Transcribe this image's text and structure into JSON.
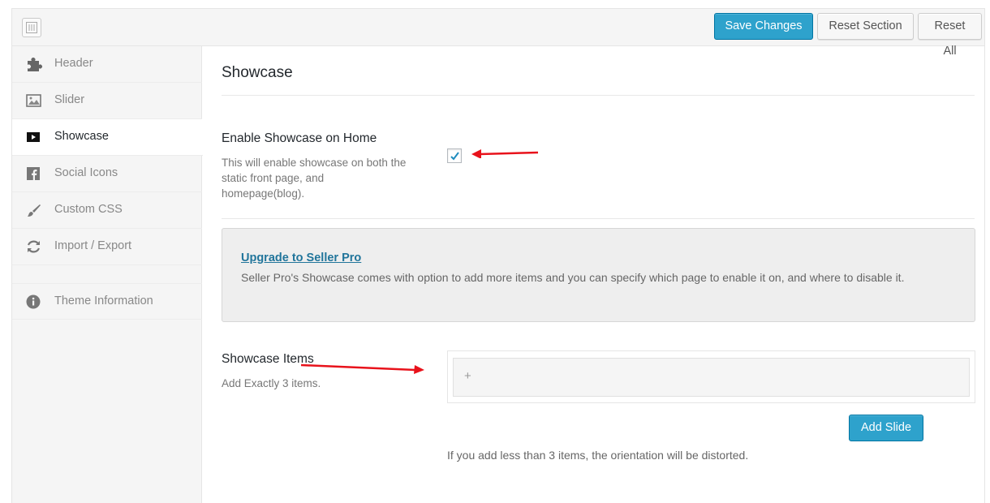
{
  "toolbar": {
    "save_label": "Save Changes",
    "reset_section_label": "Reset Section",
    "reset_all_label": "Reset All"
  },
  "sidebar": {
    "items": [
      {
        "label": "Header",
        "icon": "puzzle-icon"
      },
      {
        "label": "Slider",
        "icon": "image-icon"
      },
      {
        "label": "Showcase",
        "icon": "video-play-icon",
        "active": true
      },
      {
        "label": "Social Icons",
        "icon": "facebook-icon"
      },
      {
        "label": "Custom CSS",
        "icon": "brush-icon"
      },
      {
        "label": "Import / Export",
        "icon": "refresh-icon"
      },
      {
        "label": "Theme Information",
        "icon": "info-icon"
      }
    ]
  },
  "main": {
    "section_title": "Showcase",
    "enable_field": {
      "title": "Enable Showcase on Home",
      "desc_line1": "This will enable showcase on both the",
      "desc_line2": "static front page, and",
      "desc_line3": "homepage(blog).",
      "checked": true
    },
    "notice": {
      "link_text": "Upgrade to Seller Pro",
      "body": "Seller Pro's Showcase comes with option to add more items and you can specify which page to enable it on, and where to disable it."
    },
    "items_field": {
      "title": "Showcase Items",
      "desc": "Add Exactly 3 items.",
      "plus": "+",
      "add_label": "Add Slide",
      "warning": "If you add less than 3 items, the orientation will be distorted."
    }
  },
  "colors": {
    "primary": "#2ea2cc",
    "link": "#21759b",
    "annotation_arrow": "#e8121b"
  }
}
